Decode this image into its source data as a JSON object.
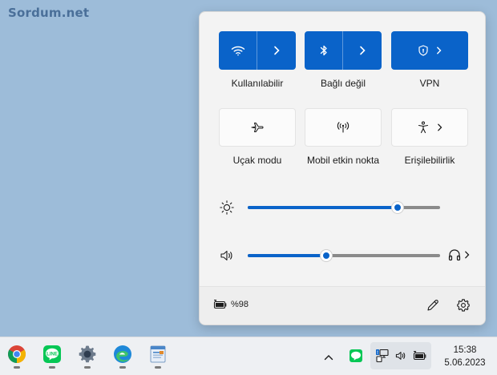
{
  "watermark": "Sordum.net",
  "tiles": [
    {
      "label": "Kullanılabilir",
      "state": "on",
      "icon": "wifi-icon",
      "split": true
    },
    {
      "label": "Bağlı değil",
      "state": "on",
      "icon": "bluetooth-icon",
      "split": true
    },
    {
      "label": "VPN",
      "state": "on",
      "icon": "vpn-shield-icon",
      "split": false
    },
    {
      "label": "Uçak modu",
      "state": "off",
      "icon": "airplane-icon"
    },
    {
      "label": "Mobil etkin nokta",
      "state": "off",
      "icon": "hotspot-icon"
    },
    {
      "label": "Erişilebilirlik",
      "state": "off",
      "icon": "accessibility-icon"
    }
  ],
  "sliders": {
    "brightness": {
      "value": 0.78,
      "icon": "brightness-icon"
    },
    "volume": {
      "value": 0.41,
      "icon": "speaker-icon",
      "output_icon": "headphones-icon"
    }
  },
  "footer": {
    "battery_text": "%98"
  },
  "taskbar": {
    "apps": [
      "chrome-icon",
      "line-icon",
      "settings-icon",
      "edge-icon",
      "app-icon"
    ],
    "time": "15:38",
    "date": "5.06.2023"
  },
  "colors": {
    "accent": "#0a63c9",
    "panel": "#f3f3f3",
    "desktop": "#9dbcd9"
  }
}
